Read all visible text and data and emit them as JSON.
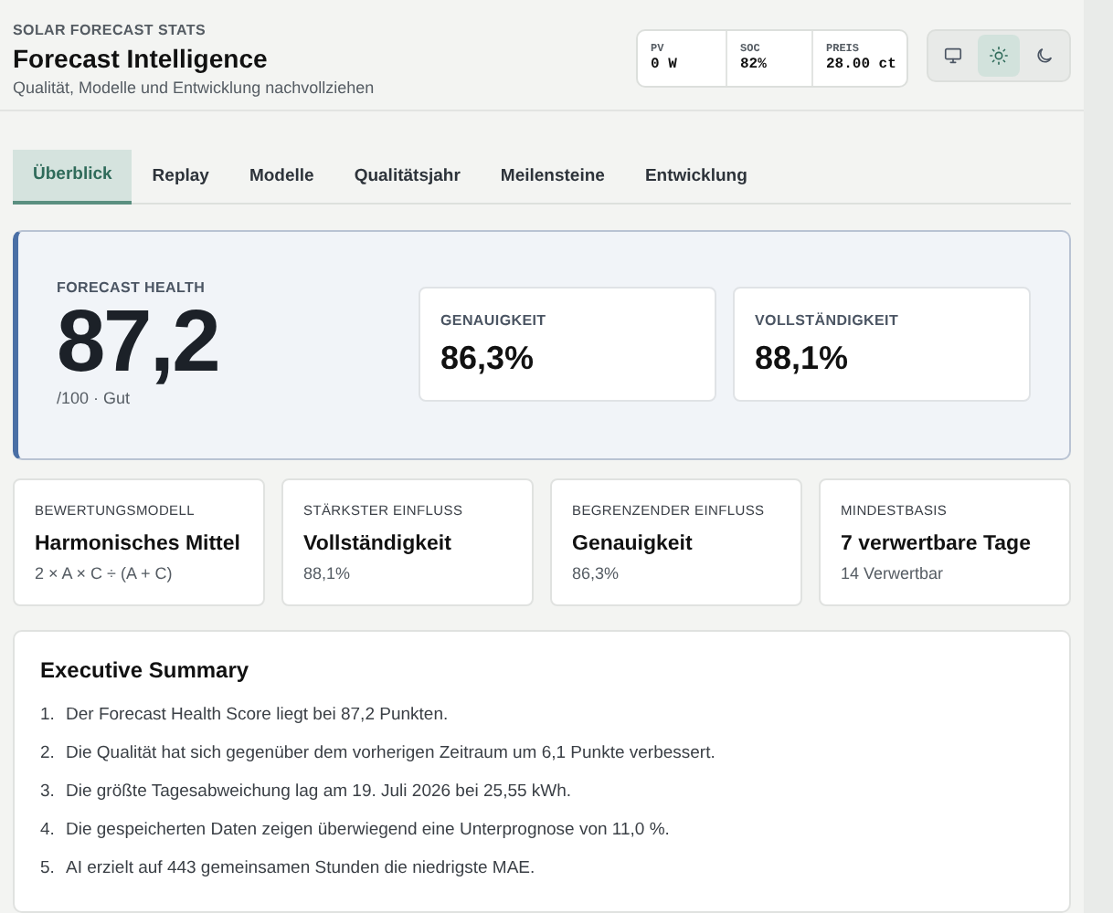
{
  "header": {
    "eyebrow": "SOLAR FORECAST STATS",
    "title": "Forecast Intelligence",
    "subtitle": "Qualität, Modelle und Entwicklung nachvollziehen"
  },
  "stats": [
    {
      "label": "PV",
      "value": "0 W"
    },
    {
      "label": "SOC",
      "value": "82%"
    },
    {
      "label": "PREIS",
      "value": "28.00 ct"
    }
  ],
  "theme_buttons": [
    {
      "kind": "monitor",
      "selected": false
    },
    {
      "kind": "sun",
      "selected": true
    },
    {
      "kind": "moon",
      "selected": false
    }
  ],
  "tabs": [
    {
      "label": "Überblick",
      "selected": true
    },
    {
      "label": "Replay",
      "selected": false
    },
    {
      "label": "Modelle",
      "selected": false
    },
    {
      "label": "Qualitätsjahr",
      "selected": false
    },
    {
      "label": "Meilensteine",
      "selected": false
    },
    {
      "label": "Entwicklung",
      "selected": false
    }
  ],
  "health": {
    "label": "FORECAST HEALTH",
    "score": "87,2",
    "caption": "/100 · Gut",
    "metrics": [
      {
        "label": "GENAUIGKEIT",
        "value": "86,3%"
      },
      {
        "label": "VOLLSTÄNDIGKEIT",
        "value": "88,1%"
      }
    ]
  },
  "cards": [
    {
      "label": "BEWERTUNGSMODELL",
      "value": "Harmonisches Mittel",
      "detail": "2 × A × C ÷ (A + C)"
    },
    {
      "label": "STÄRKSTER EINFLUSS",
      "value": "Vollständigkeit",
      "detail": "88,1%"
    },
    {
      "label": "BEGRENZENDER EINFLUSS",
      "value": "Genauigkeit",
      "detail": "86,3%"
    },
    {
      "label": "MINDESTBASIS",
      "value": "7 verwertbare Tage",
      "detail": "14 Verwertbar"
    }
  ],
  "summary": {
    "title": "Executive Summary",
    "items": [
      {
        "number": "1.",
        "text": "Der Forecast Health Score liegt bei 87,2 Punkten."
      },
      {
        "number": "2.",
        "text": "Die Qualität hat sich gegenüber dem vorherigen Zeitraum um 6,1 Punkte verbessert."
      },
      {
        "number": "3.",
        "text": "Die größte Tagesabweichung lag am 19. Juli 2026 bei 25,55 kWh."
      },
      {
        "number": "4.",
        "text": "Die gespeicherten Daten zeigen überwiegend eine Unterprognose von 11,0 %."
      },
      {
        "number": "5.",
        "text": "AI erzielt auf 443 gemeinsamen Stunden die niedrigste MAE."
      }
    ]
  }
}
